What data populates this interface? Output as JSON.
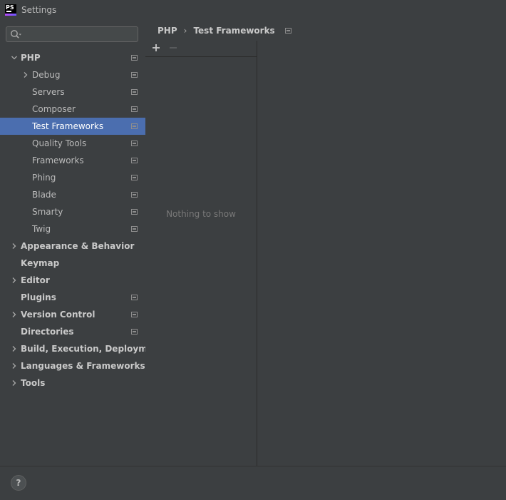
{
  "window": {
    "title": "Settings",
    "app_icon_text": "PS"
  },
  "search": {
    "placeholder": "",
    "value": ""
  },
  "tree": [
    {
      "label": "PHP",
      "level": 0,
      "bold": true,
      "arrow": "expanded",
      "project": true,
      "selected": false
    },
    {
      "label": "Debug",
      "level": 1,
      "bold": false,
      "arrow": "collapsed",
      "project": true,
      "selected": false
    },
    {
      "label": "Servers",
      "level": 1,
      "bold": false,
      "arrow": "none",
      "project": true,
      "selected": false
    },
    {
      "label": "Composer",
      "level": 1,
      "bold": false,
      "arrow": "none",
      "project": true,
      "selected": false
    },
    {
      "label": "Test Frameworks",
      "level": 1,
      "bold": false,
      "arrow": "none",
      "project": true,
      "selected": true
    },
    {
      "label": "Quality Tools",
      "level": 1,
      "bold": false,
      "arrow": "none",
      "project": true,
      "selected": false
    },
    {
      "label": "Frameworks",
      "level": 1,
      "bold": false,
      "arrow": "none",
      "project": true,
      "selected": false
    },
    {
      "label": "Phing",
      "level": 1,
      "bold": false,
      "arrow": "none",
      "project": true,
      "selected": false
    },
    {
      "label": "Blade",
      "level": 1,
      "bold": false,
      "arrow": "none",
      "project": true,
      "selected": false
    },
    {
      "label": "Smarty",
      "level": 1,
      "bold": false,
      "arrow": "none",
      "project": true,
      "selected": false
    },
    {
      "label": "Twig",
      "level": 1,
      "bold": false,
      "arrow": "none",
      "project": true,
      "selected": false
    },
    {
      "label": "Appearance & Behavior",
      "level": 0,
      "bold": true,
      "arrow": "collapsed",
      "project": false,
      "selected": false
    },
    {
      "label": "Keymap",
      "level": 0,
      "bold": true,
      "arrow": "none",
      "project": false,
      "selected": false
    },
    {
      "label": "Editor",
      "level": 0,
      "bold": true,
      "arrow": "collapsed",
      "project": false,
      "selected": false
    },
    {
      "label": "Plugins",
      "level": 0,
      "bold": true,
      "arrow": "none",
      "project": true,
      "selected": false
    },
    {
      "label": "Version Control",
      "level": 0,
      "bold": true,
      "arrow": "collapsed",
      "project": true,
      "selected": false
    },
    {
      "label": "Directories",
      "level": 0,
      "bold": true,
      "arrow": "none",
      "project": true,
      "selected": false
    },
    {
      "label": "Build, Execution, Deployment",
      "level": 0,
      "bold": true,
      "arrow": "collapsed",
      "project": false,
      "selected": false
    },
    {
      "label": "Languages & Frameworks",
      "level": 0,
      "bold": true,
      "arrow": "collapsed",
      "project": false,
      "selected": false
    },
    {
      "label": "Tools",
      "level": 0,
      "bold": true,
      "arrow": "collapsed",
      "project": false,
      "selected": false
    }
  ],
  "breadcrumb": {
    "parent": "PHP",
    "separator": "›",
    "current": "Test Frameworks"
  },
  "list": {
    "empty_text": "Nothing to show"
  },
  "footer": {
    "help_label": "?"
  },
  "colors": {
    "background": "#3c3f41",
    "selection": "#4b6eaf",
    "border": "#2b2b2b"
  }
}
